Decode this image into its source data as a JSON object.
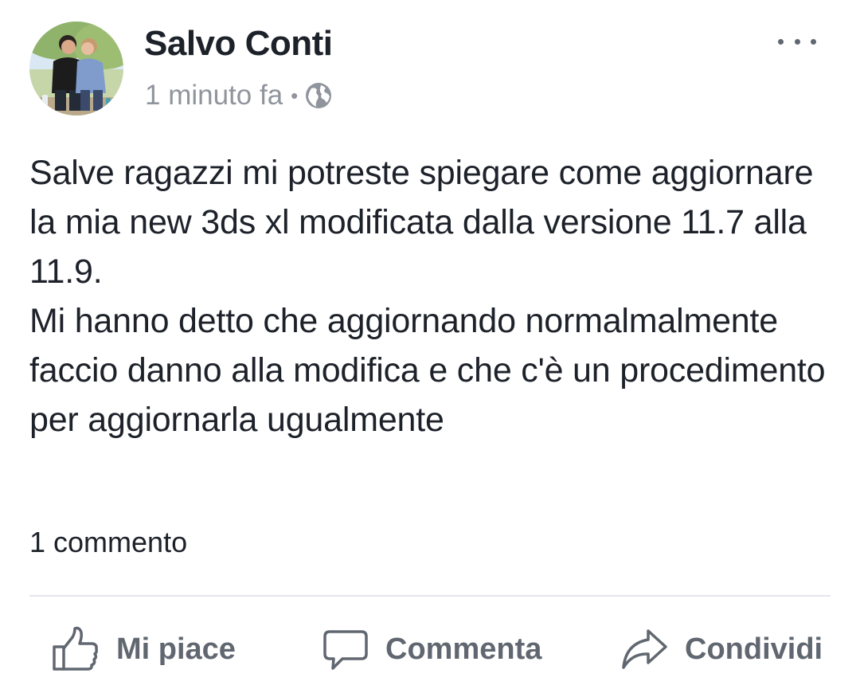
{
  "post": {
    "author": "Salvo Conti",
    "timestamp": "1 minuto fa",
    "separator": "•",
    "privacy_icon": "globe-icon",
    "more_icon": "more-options-icon",
    "text": "Salve ragazzi mi potreste spiegare come aggiornare la mia new 3ds xl modificata dalla versione 11.7 alla 11.9.\nMi hanno detto che aggiornando normalmalmente faccio danno alla modifica e che c'è un procedimento per aggiornarla ugualmente",
    "comment_count": "1 commento"
  },
  "actions": {
    "like_label": "Mi piace",
    "comment_label": "Commenta",
    "share_label": "Condividi"
  },
  "colors": {
    "text_primary": "#1d2129",
    "text_secondary": "#90949c",
    "action_text": "#606770",
    "divider": "#e4e6eb"
  }
}
